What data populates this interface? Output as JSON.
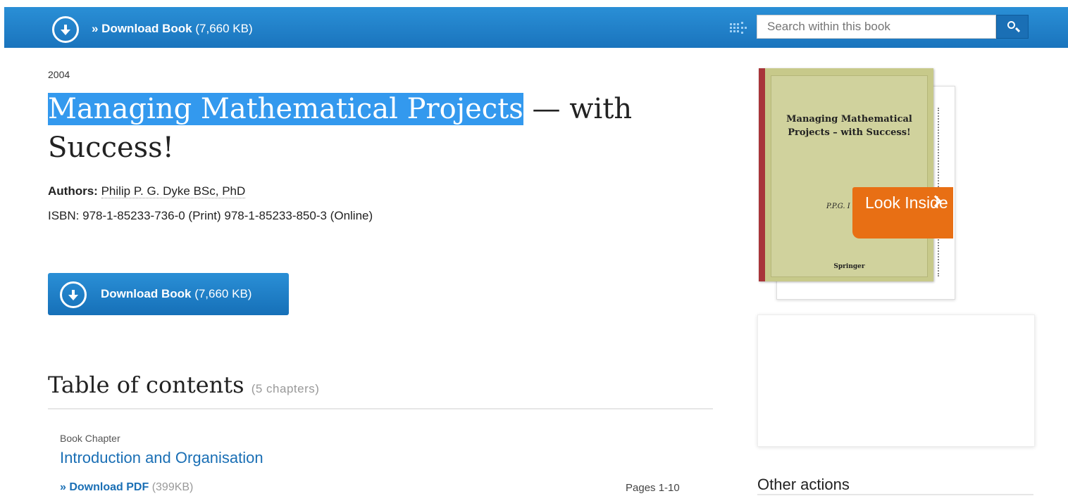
{
  "topbar": {
    "download_prefix": "» Download Book",
    "download_size": "(7,660 KB)",
    "search_placeholder": "Search within this book"
  },
  "book": {
    "year": "2004",
    "title_highlight": "Managing Mathematical Projects",
    "title_rest": " — with Success!",
    "authors_label": "Authors:",
    "authors_value": "Philip P. G. Dyke BSc, PhD",
    "isbn": "ISBN: 978-1-85233-736-0 (Print) 978-1-85233-850-3 (Online)"
  },
  "download_button": {
    "label": "Download Book",
    "size": "(7,660 KB)"
  },
  "cover": {
    "title": "Managing Mathematical Projects – with Success!",
    "author": "P.P.G. I",
    "publisher": "Springer",
    "look_inside": "Look Inside"
  },
  "toc": {
    "title": "Table of contents",
    "count": "(5 chapters)",
    "chapters": [
      {
        "type": "Book Chapter",
        "title": "Introduction and Organisation",
        "pdf_label": "» Download PDF",
        "pdf_size": "(399KB)",
        "pages": "Pages 1-10"
      }
    ]
  },
  "sidebar": {
    "other_actions": "Other actions"
  }
}
